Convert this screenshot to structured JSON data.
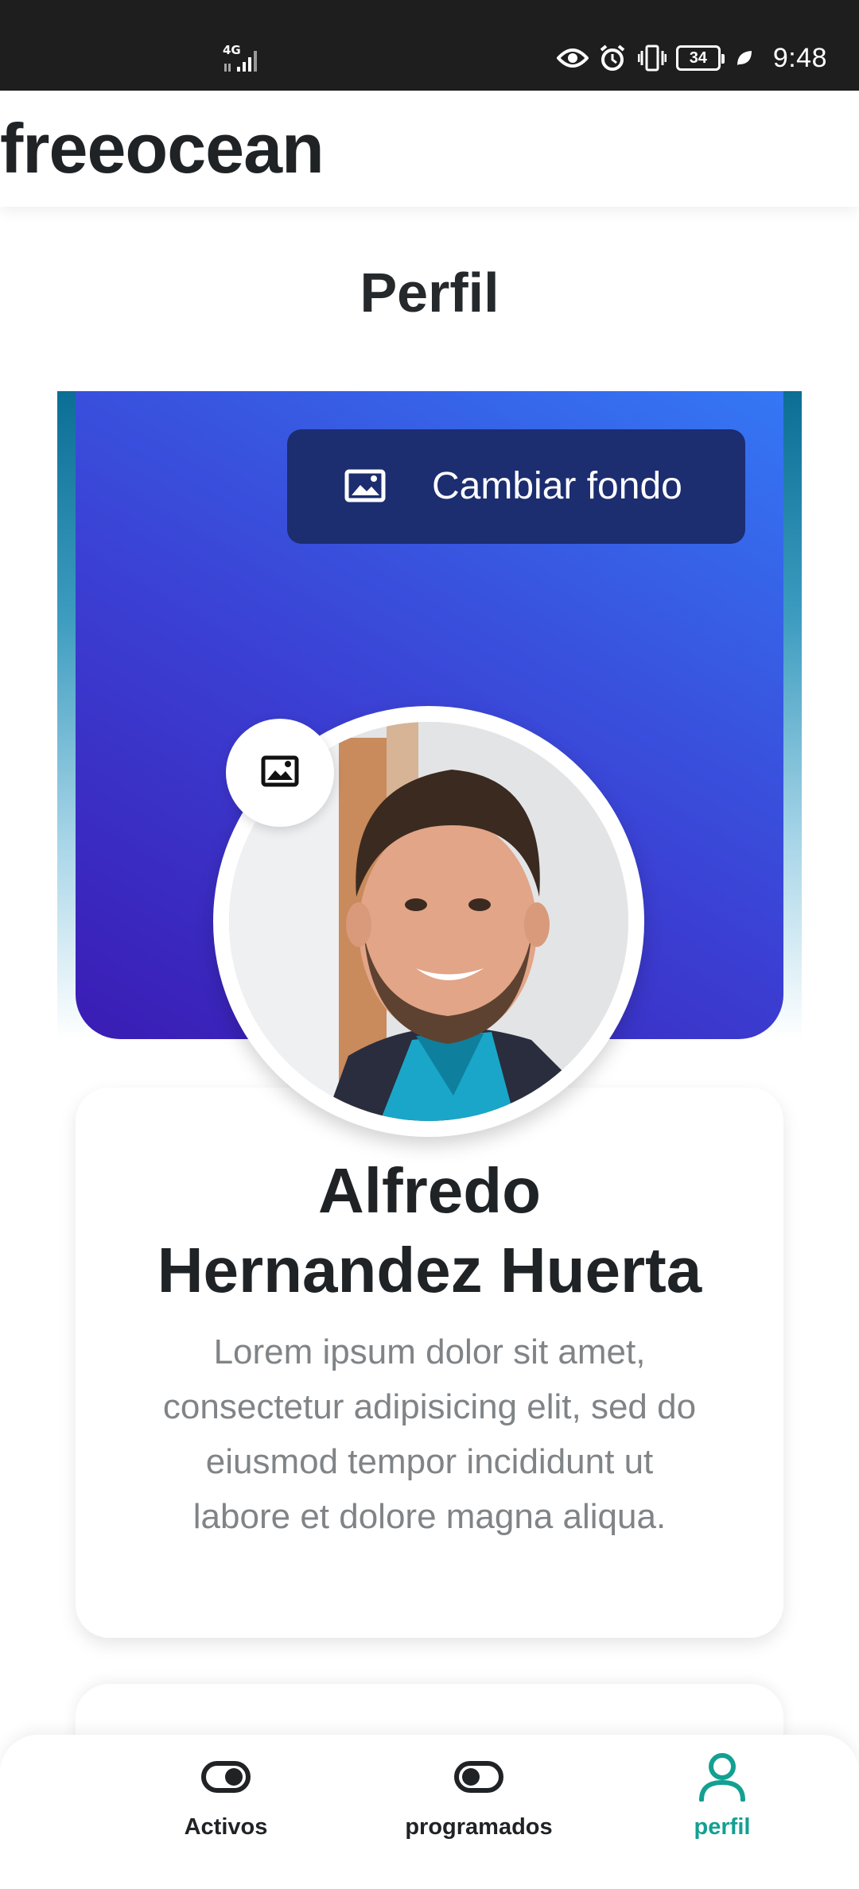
{
  "status_bar": {
    "network": "4G",
    "battery": "34",
    "time": "9:48",
    "icons": [
      "signal-icon",
      "eye-icon",
      "alarm-icon",
      "vibrate-icon",
      "battery-icon",
      "leaf-icon"
    ]
  },
  "app": {
    "brand": "freeocean"
  },
  "page": {
    "title": "Perfil"
  },
  "cover": {
    "change_background_label": "Cambiar fondo",
    "change_background_icon": "image-icon"
  },
  "profile": {
    "name_line1": "Alfredo",
    "name_line2": "Hernandez Huerta",
    "bio": "Lorem ipsum dolor sit amet, consectetur adipisicing elit, sed do eiusmod tempor incididunt ut labore et dolore magna aliqua.",
    "avatar_edit_icon": "image-icon"
  },
  "bottom_nav": {
    "items": [
      {
        "label": "Activos",
        "icon": "toggle-on-icon",
        "active": false
      },
      {
        "label": "programados",
        "icon": "toggle-off-icon",
        "active": false
      },
      {
        "label": "perfil",
        "icon": "user-icon",
        "active": true
      }
    ]
  },
  "colors": {
    "accent": "#13a092",
    "cover_gradient_start": "#3a1cb4",
    "cover_gradient_end": "#3477f4",
    "button_bg": "#1c2d70",
    "status_bar_bg": "#1e1e1e",
    "text_primary": "#1f2326",
    "text_secondary": "#808487"
  }
}
